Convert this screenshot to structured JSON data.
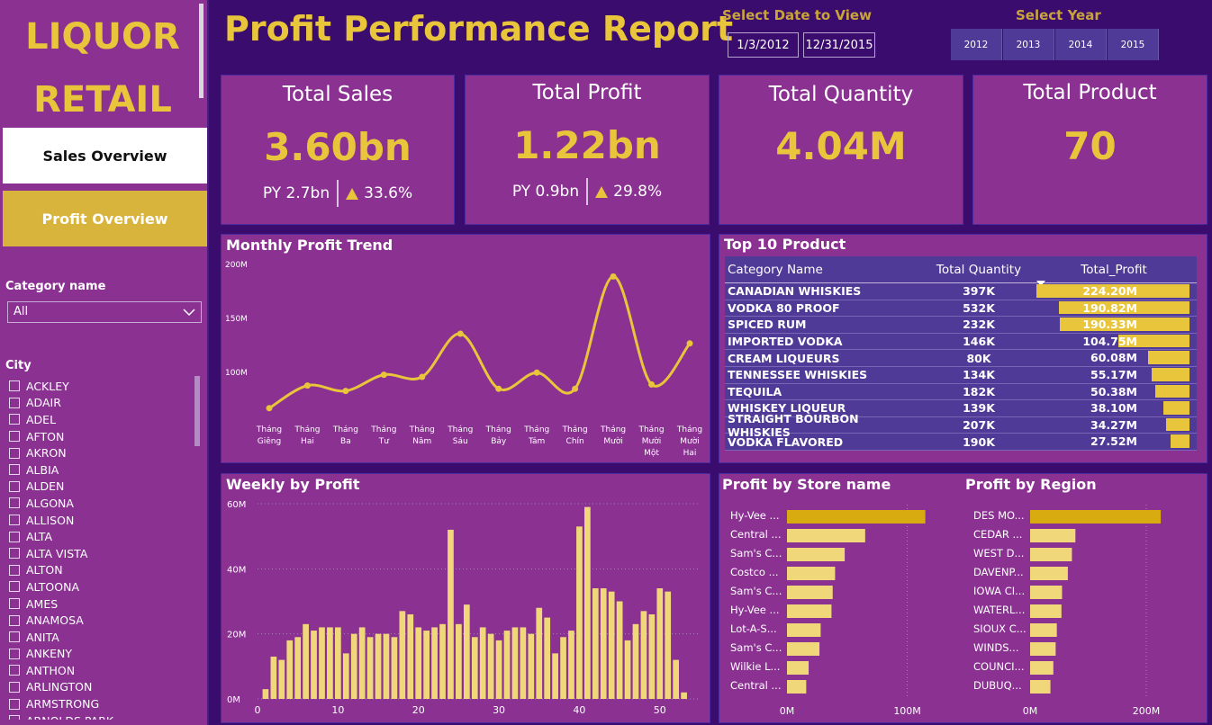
{
  "sidebar": {
    "brand_line1": "LIQUOR",
    "brand_line2": "RETAIL",
    "nav_sales": "Sales Overview",
    "nav_profit": "Profit Overview",
    "category_label": "Category name",
    "category_value": "All",
    "city_label": "City",
    "cities": [
      "ACKLEY",
      "ADAIR",
      "ADEL",
      "AFTON",
      "AKRON",
      "ALBIA",
      "ALDEN",
      "ALGONA",
      "ALLISON",
      "ALTA",
      "ALTA VISTA",
      "ALTON",
      "ALTOONA",
      "AMES",
      "ANAMOSA",
      "ANITA",
      "ANKENY",
      "ANTHON",
      "ARLINGTON",
      "ARMSTRONG",
      "ARNOLDS PARK"
    ]
  },
  "header": {
    "title": "Profit Performance Report",
    "date_label": "Select Date to View",
    "date_start": "1/3/2012",
    "date_end": "12/31/2015",
    "year_label": "Select Year",
    "years": [
      "2012",
      "2013",
      "2014",
      "2015"
    ]
  },
  "kpis": {
    "sales": {
      "title": "Total Sales",
      "value": "3.60bn",
      "py": "PY 2.7bn",
      "change": "33.6%"
    },
    "profit": {
      "title": "Total Profit",
      "value": "1.22bn",
      "py": "PY 0.9bn",
      "change": "29.8%"
    },
    "quantity": {
      "title": "Total Quantity",
      "value": "4.04M"
    },
    "product": {
      "title": "Total Product",
      "value": "70"
    }
  },
  "colors": {
    "accent": "#e8c53a",
    "panel": "#8a3192",
    "background": "#3a0c6e",
    "table": "#4f3a98",
    "bar_light": "#f0d779",
    "bar_dark": "#d8ac10"
  },
  "monthly": {
    "title": "Monthly Profit Trend",
    "chart_data": {
      "type": "line",
      "categories": [
        [
          "Tháng",
          "Giêng"
        ],
        [
          "Tháng",
          "Hai"
        ],
        [
          "Tháng",
          "Ba"
        ],
        [
          "Tháng",
          "Tư"
        ],
        [
          "Tháng",
          "Năm"
        ],
        [
          "Tháng",
          "Sáu"
        ],
        [
          "Tháng",
          "Bảy"
        ],
        [
          "Tháng",
          "Tám"
        ],
        [
          "Tháng",
          "Chín"
        ],
        [
          "Tháng",
          "Mười"
        ],
        [
          "Tháng",
          "Mười",
          "Một"
        ],
        [
          "Tháng",
          "Mười",
          "Hai"
        ]
      ],
      "values": [
        66,
        87,
        82,
        97,
        95,
        135,
        84,
        99,
        84,
        188,
        88,
        126
      ],
      "yticks": [
        {
          "v": 100,
          "label": "100M"
        },
        {
          "v": 150,
          "label": "150M"
        },
        {
          "v": 200,
          "label": "200M"
        }
      ],
      "ylim": [
        50,
        200
      ],
      "grid": false
    }
  },
  "top10": {
    "title": "Top 10 Product",
    "headers": [
      "Category Name",
      "Total Quantity",
      "Total_Profit"
    ],
    "rows": [
      {
        "name": "CANADIAN WHISKIES",
        "qty": "397K",
        "profit": "224.20M",
        "value": 224.2
      },
      {
        "name": "VODKA 80 PROOF",
        "qty": "532K",
        "profit": "190.82M",
        "value": 190.82
      },
      {
        "name": "SPICED RUM",
        "qty": "232K",
        "profit": "190.33M",
        "value": 190.33
      },
      {
        "name": "IMPORTED VODKA",
        "qty": "146K",
        "profit": "104.75M",
        "value": 104.75
      },
      {
        "name": "CREAM LIQUEURS",
        "qty": "80K",
        "profit": "60.08M",
        "value": 60.08
      },
      {
        "name": "TENNESSEE WHISKIES",
        "qty": "134K",
        "profit": "55.17M",
        "value": 55.17
      },
      {
        "name": "TEQUILA",
        "qty": "182K",
        "profit": "50.38M",
        "value": 50.38
      },
      {
        "name": "WHISKEY LIQUEUR",
        "qty": "139K",
        "profit": "38.10M",
        "value": 38.1
      },
      {
        "name": "STRAIGHT BOURBON WHISKIES",
        "qty": "207K",
        "profit": "34.27M",
        "value": 34.27
      },
      {
        "name": "VODKA FLAVORED",
        "qty": "190K",
        "profit": "27.52M",
        "value": 27.52
      }
    ]
  },
  "weekly": {
    "title": "Weekly by Profit",
    "chart_data": {
      "type": "bar",
      "x": [
        1,
        2,
        3,
        4,
        5,
        6,
        7,
        8,
        9,
        10,
        11,
        12,
        13,
        14,
        15,
        16,
        17,
        18,
        19,
        20,
        21,
        22,
        23,
        24,
        25,
        26,
        27,
        28,
        29,
        30,
        31,
        32,
        33,
        34,
        35,
        36,
        37,
        38,
        39,
        40,
        41,
        42,
        43,
        44,
        45,
        46,
        47,
        48,
        49,
        50,
        51,
        52,
        53
      ],
      "values": [
        3,
        13,
        12,
        18,
        19,
        23,
        21,
        22,
        22,
        22,
        14,
        20,
        22,
        19,
        20,
        20,
        19,
        27,
        26,
        22,
        21,
        22,
        23,
        52,
        23,
        29,
        19,
        22,
        20,
        18,
        21,
        22,
        22,
        20,
        28,
        25,
        14,
        19,
        21,
        53,
        59,
        34,
        34,
        33,
        30,
        18,
        23,
        27,
        26,
        34,
        33,
        12,
        2
      ],
      "xticks": [
        0,
        10,
        20,
        30,
        40,
        50
      ],
      "yticks": [
        {
          "v": 0,
          "label": "0M"
        },
        {
          "v": 20,
          "label": "20M"
        },
        {
          "v": 40,
          "label": "40M"
        },
        {
          "v": 60,
          "label": "60M"
        }
      ],
      "ylim": [
        0,
        60
      ]
    }
  },
  "store": {
    "title": "Profit by Store name",
    "chart_data": {
      "type": "bar",
      "categories": [
        "Hy-Vee ...",
        "Central ...",
        "Sam's C...",
        "Costco ...",
        "Sam's C...",
        "Hy-Vee ...",
        "Lot-A-S...",
        "Sam's C...",
        "Wilkie L...",
        "Central ..."
      ],
      "values": [
        115,
        65,
        48,
        40,
        38,
        37,
        28,
        27,
        18,
        16
      ],
      "xticks": [
        {
          "v": 0,
          "label": "0M"
        },
        {
          "v": 100,
          "label": "100M"
        }
      ],
      "xlim": [
        0,
        140
      ]
    }
  },
  "region": {
    "title": "Profit by Region",
    "chart_data": {
      "type": "bar",
      "categories": [
        "DES MO...",
        "CEDAR ...",
        "WEST D...",
        "DAVENP...",
        "IOWA CI...",
        "WATERL...",
        "SIOUX C...",
        "WINDS...",
        "COUNCI...",
        "DUBUQ..."
      ],
      "values": [
        225,
        78,
        72,
        65,
        55,
        54,
        46,
        44,
        40,
        35
      ],
      "xticks": [
        {
          "v": 0,
          "label": "0M"
        },
        {
          "v": 200,
          "label": "200M"
        }
      ],
      "xlim": [
        0,
        290
      ]
    }
  }
}
